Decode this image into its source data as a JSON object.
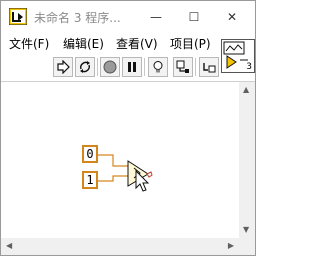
{
  "window": {
    "title": "未命名 3 程序...",
    "minimize_symbol": "—",
    "maximize_symbol": "☐",
    "close_symbol": "✕"
  },
  "menu": {
    "items": [
      "文件(F)",
      "编辑(E)",
      "查看(V)",
      "项目(P)"
    ]
  },
  "toolbar": {
    "buttons": [
      "run-arrow-icon",
      "run-continuously-icon",
      "abort-icon",
      "pause-icon",
      "highlight-execution-icon",
      "retain-wire-values-icon",
      "step-into-icon"
    ]
  },
  "connector_pane": {
    "number": "3"
  },
  "diagram": {
    "constant_top": "0",
    "constant_bottom": "1",
    "function": "greater-comparison",
    "wire_color": "#d4861d"
  },
  "colors": {
    "wire": "#d4861d",
    "stop": "#c83a2a"
  }
}
